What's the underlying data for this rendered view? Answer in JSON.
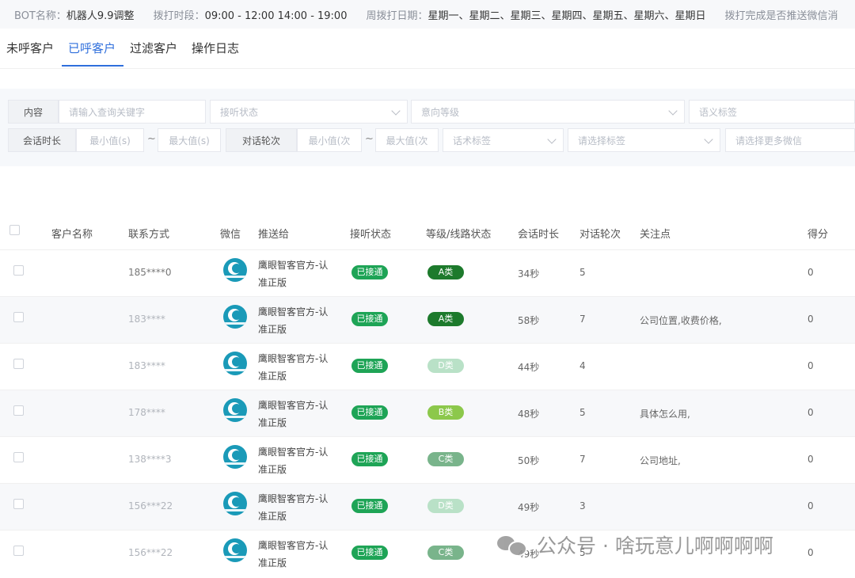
{
  "info": {
    "bot_name_label": "BOT名称：",
    "bot_name": "机器人9.9调整",
    "time_label": "拨打时段：",
    "time": "09:00 - 12:00 14:00 - 19:00",
    "weekday_label": "周拨打日期：",
    "weekdays": "星期一、星期二、星期三、星期四、星期五、星期六、星期日",
    "push_label": "拨打完成是否推送微信消"
  },
  "tabs": [
    "未呼客户",
    "已呼客户",
    "过滤客户",
    "操作日志"
  ],
  "filters": {
    "content_label": "内容",
    "content_placeholder": "请输入查询关键字",
    "answer_status": "接听状态",
    "intent_level": "意向等级",
    "semantic_tag": "语义标签",
    "duration_label": "会话时长",
    "min_seconds": "最小值(s)",
    "max_seconds": "最大值(s)",
    "rounds_label": "对话轮次",
    "min_rounds": "最小值(次",
    "max_rounds": "最大值(次",
    "script_tag": "话术标签",
    "select_tag": "请选择标签",
    "select_wechat": "请选择更多微信",
    "tilde": "~"
  },
  "table": {
    "headers": [
      "客户名称",
      "联系方式",
      "微信",
      "推送给",
      "接听状态",
      "等级/线路状态",
      "会话时长",
      "对话轮次",
      "关注点",
      "得分"
    ],
    "rows": [
      {
        "phone": "185****0",
        "push": "鹰眼智客官方-认准正版",
        "status": "已接通",
        "level": "A类",
        "duration": "34秒",
        "rounds": "5",
        "focus": "",
        "score": "0"
      },
      {
        "phone": "183****",
        "push": "鹰眼智客官方-认准正版",
        "status": "已接通",
        "level": "A类",
        "duration": "58秒",
        "rounds": "7",
        "focus": "公司位置,收费价格,",
        "score": "0"
      },
      {
        "phone": "183****",
        "push": "鹰眼智客官方-认准正版",
        "status": "已接通",
        "level": "D类",
        "duration": "44秒",
        "rounds": "4",
        "focus": "",
        "score": "0"
      },
      {
        "phone": "178****",
        "push": "鹰眼智客官方-认准正版",
        "status": "已接通",
        "level": "B类",
        "duration": "48秒",
        "rounds": "5",
        "focus": "具体怎么用,",
        "score": "0"
      },
      {
        "phone": "138****3",
        "push": "鹰眼智客官方-认准正版",
        "status": "已接通",
        "level": "C类",
        "duration": "50秒",
        "rounds": "7",
        "focus": "公司地址,",
        "score": "0"
      },
      {
        "phone": "156***22",
        "push": "鹰眼智客官方-认准正版",
        "status": "已接通",
        "level": "D类",
        "duration": "49秒",
        "rounds": "3",
        "focus": "",
        "score": "0"
      },
      {
        "phone": "156***22",
        "push": "鹰眼智客官方-认准正版",
        "status": "已接通",
        "level": "C类",
        "duration": "49秒",
        "rounds": "5",
        "focus": "",
        "score": "0"
      }
    ]
  },
  "level_colors": {
    "A类": "#1d7a2c",
    "B类": "#8cc84b",
    "C类": "#79b48b",
    "D类": "#b9e1c7"
  },
  "status_color": "#1ea456",
  "watermark": "公众号 · 啥玩意儿啊啊啊啊"
}
